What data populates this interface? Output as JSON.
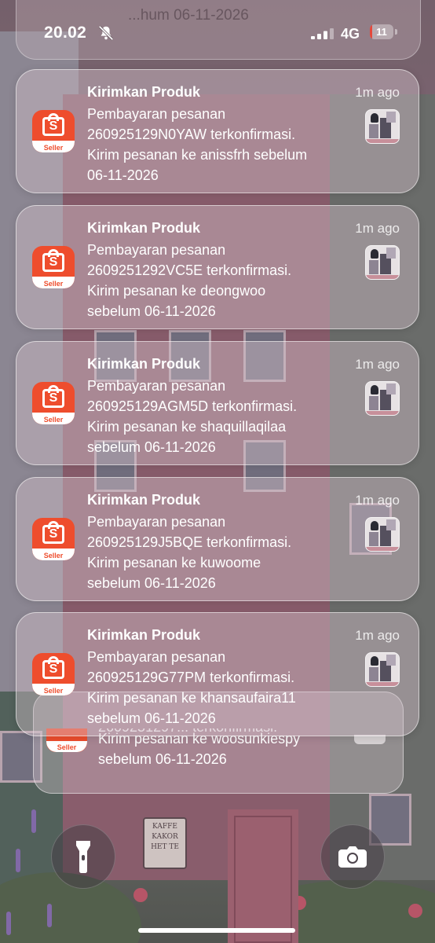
{
  "status_bar": {
    "time": "20.02",
    "network": "4G",
    "battery_level": "11",
    "battery_fraction": 0.11,
    "signal_bars": "3 of 4"
  },
  "colors": {
    "shopee_orange": "#ee4d2d",
    "battery_low": "#e5483b",
    "text": "#ffffff"
  },
  "icons": {
    "app": "shopee-seller-icon",
    "thumbnail": "product-thumbnail",
    "flashlight": "flashlight-icon",
    "camera": "camera-icon",
    "mute": "bell-off-icon"
  },
  "top_card": {
    "partial_text": "...hum 06-11-2026"
  },
  "notifications": [
    {
      "title": "Kirimkan Produk",
      "time_ago": "1m ago",
      "line1": "Pembayaran pesanan",
      "line2": "260925129N0YAW terkonfirmasi.",
      "line3": "Kirim pesanan ke anissfrh sebelum",
      "line4": "06-11-2026",
      "app_label": "Seller"
    },
    {
      "title": "Kirimkan Produk",
      "time_ago": "1m ago",
      "line1": "Pembayaran pesanan",
      "line2": "2609251292VC5E terkonfirmasi.",
      "line3": "Kirim pesanan ke deongwoo",
      "line4": "sebelum 06-11-2026",
      "app_label": "Seller"
    },
    {
      "title": "Kirimkan Produk",
      "time_ago": "1m ago",
      "line1": "Pembayaran pesanan",
      "line2": "260925129AGM5D terkonfirmasi.",
      "line3": "Kirim pesanan ke shaquillaqilaa",
      "line4": "sebelum 06-11-2026",
      "app_label": "Seller"
    },
    {
      "title": "Kirimkan Produk",
      "time_ago": "1m ago",
      "line1": "Pembayaran pesanan",
      "line2": "260925129J5BQE terkonfirmasi.",
      "line3": "Kirim pesanan ke kuwoome",
      "line4": "sebelum 06-11-2026",
      "app_label": "Seller"
    },
    {
      "title": "Kirimkan Produk",
      "time_ago": "1m ago",
      "line1": "Pembayaran pesanan",
      "line2": "260925129G77PM terkonfirmasi.",
      "line3": "Kirim pesanan ke khansaufaira11",
      "line4": "sebelum 06-11-2026",
      "app_label": "Seller"
    }
  ],
  "stacked_notification": {
    "line1": "Kirim pesanan ke woosunkiespy",
    "line2": "sebelum 06-11-2026",
    "app_label": "Seller"
  },
  "wallpaper": {
    "sign_line1": "KAFFE",
    "sign_line2": "KAKOR",
    "sign_line3": "HET TE"
  }
}
